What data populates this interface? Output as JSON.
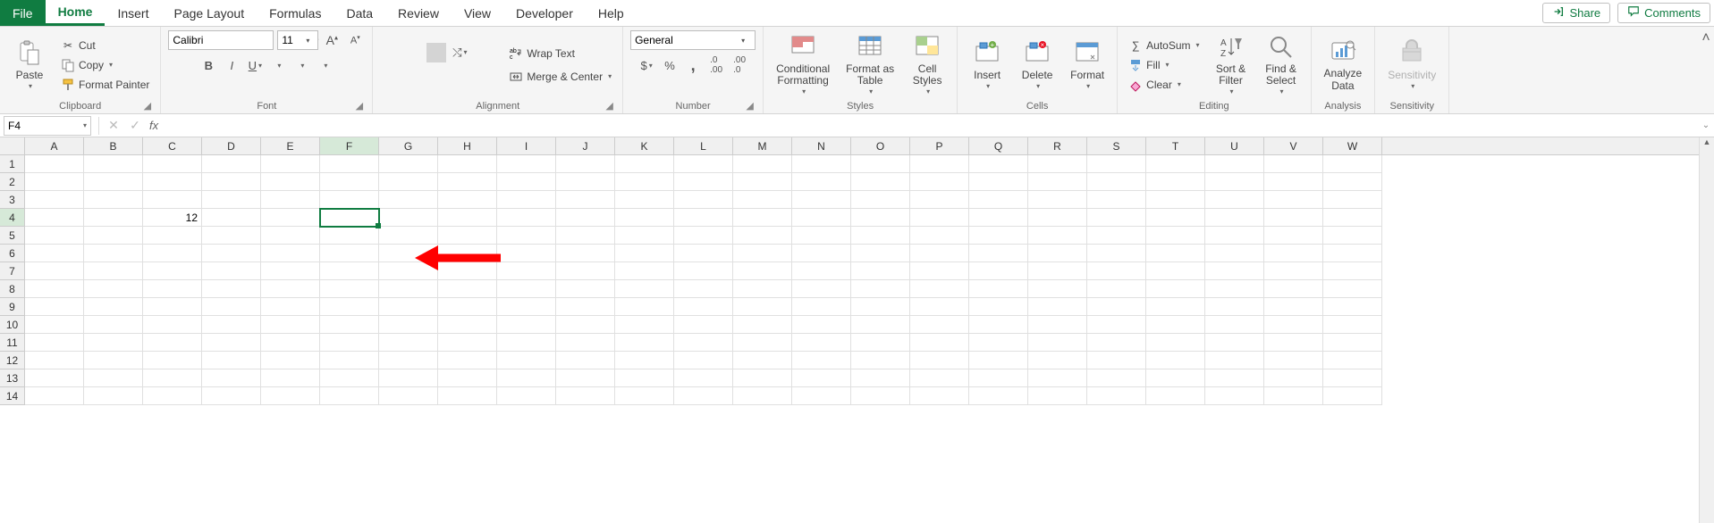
{
  "tabs": {
    "file": "File",
    "home": "Home",
    "insert": "Insert",
    "page_layout": "Page Layout",
    "formulas": "Formulas",
    "data": "Data",
    "review": "Review",
    "view": "View",
    "developer": "Developer",
    "help": "Help",
    "active": "home",
    "share": "Share",
    "comments": "Comments"
  },
  "ribbon": {
    "clipboard": {
      "label": "Clipboard",
      "paste": "Paste",
      "cut": "Cut",
      "copy": "Copy",
      "format_painter": "Format Painter"
    },
    "font": {
      "label": "Font",
      "font_name": "Calibri",
      "font_size": "11"
    },
    "alignment": {
      "label": "Alignment",
      "wrap_text": "Wrap Text",
      "merge_center": "Merge & Center"
    },
    "number": {
      "label": "Number",
      "format": "General"
    },
    "styles": {
      "label": "Styles",
      "conditional": "Conditional\nFormatting",
      "format_table": "Format as\nTable",
      "cell_styles": "Cell\nStyles"
    },
    "cells": {
      "label": "Cells",
      "insert": "Insert",
      "delete": "Delete",
      "format": "Format"
    },
    "editing": {
      "label": "Editing",
      "autosum": "AutoSum",
      "fill": "Fill",
      "clear": "Clear",
      "sort_filter": "Sort &\nFilter",
      "find_select": "Find &\nSelect"
    },
    "analysis": {
      "label": "Analysis",
      "analyze": "Analyze\nData"
    },
    "sensitivity": {
      "label": "Sensitivity",
      "btn": "Sensitivity"
    }
  },
  "formula_bar": {
    "cell_ref": "F4",
    "formula": ""
  },
  "sheet": {
    "columns": [
      "A",
      "B",
      "C",
      "D",
      "E",
      "F",
      "G",
      "H",
      "I",
      "J",
      "K",
      "L",
      "M",
      "N",
      "O",
      "P",
      "Q",
      "R",
      "S",
      "T",
      "U",
      "V",
      "W"
    ],
    "rows": [
      1,
      2,
      3,
      4,
      5,
      6,
      7,
      8,
      9,
      10,
      11,
      12,
      13,
      14
    ],
    "active_cell": "F4",
    "active_col": "F",
    "active_row": 4,
    "cells": {
      "C4": "12"
    }
  }
}
